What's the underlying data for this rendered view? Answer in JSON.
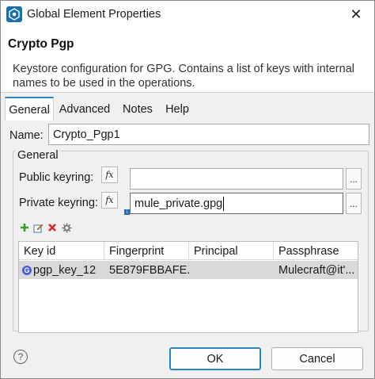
{
  "window": {
    "title": "Global Element Properties",
    "close_glyph": "✕"
  },
  "header": {
    "title": "Crypto Pgp",
    "description": "Keystore configuration for GPG. Contains a list of keys with internal names to be used in the operations."
  },
  "tabs": [
    {
      "label": "General",
      "active": true
    },
    {
      "label": "Advanced",
      "active": false
    },
    {
      "label": "Notes",
      "active": false
    },
    {
      "label": "Help",
      "active": false
    }
  ],
  "form": {
    "name_label": "Name:",
    "name_value": "Crypto_Pgp1",
    "group_title": "General",
    "public_keyring_label": "Public keyring:",
    "public_keyring_value": "",
    "private_keyring_label": "Private keyring:",
    "private_keyring_value": "mule_private.gpg",
    "fx_label": "fx",
    "browse_label": "..."
  },
  "toolbar": {
    "icons": [
      "add-icon",
      "edit-icon",
      "delete-icon",
      "settings-icon"
    ]
  },
  "table": {
    "columns": [
      "Key id",
      "Fingerprint",
      "Principal",
      "Passphrase"
    ],
    "rows": [
      {
        "key_id": "pgp_key_12",
        "fingerprint": "5E879FBBAFE...",
        "principal": "",
        "passphrase": "Mulecraft@it'..."
      }
    ]
  },
  "footer": {
    "help_glyph": "?",
    "ok_label": "OK",
    "cancel_label": "Cancel"
  },
  "colors": {
    "accent": "#2b84c6",
    "selected_row": "#d9d9d9",
    "key_badge": "#4a5fd9"
  }
}
